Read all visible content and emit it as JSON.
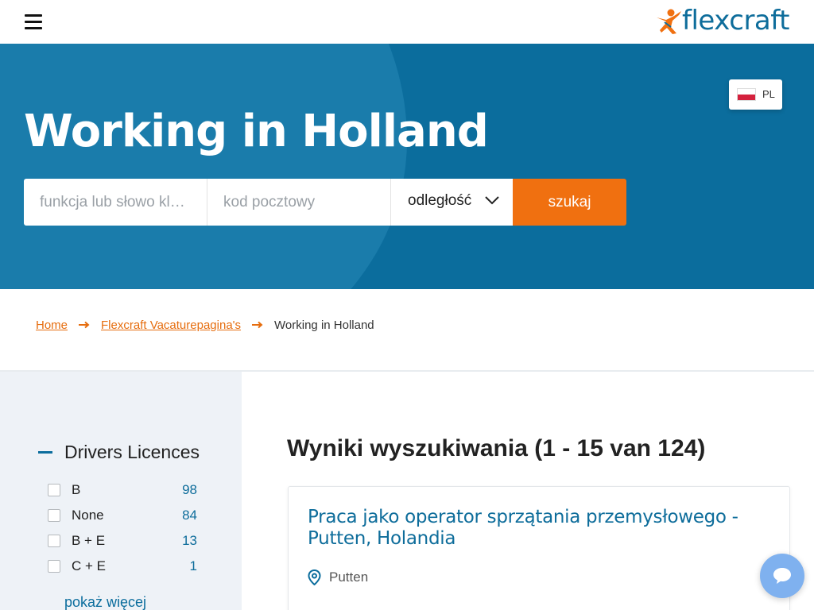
{
  "header": {
    "menu_icon": "hamburger-icon",
    "logo_text": "flexcraft"
  },
  "hero": {
    "title": "Working in Holland",
    "language": {
      "code": "PL",
      "flag": "poland-flag-icon"
    },
    "search": {
      "keyword_placeholder": "funkcja lub słowo kl…",
      "postal_placeholder": "kod pocztowy",
      "distance_value": "odległość",
      "submit_label": "szukaj"
    }
  },
  "breadcrumb": {
    "items": [
      "Home",
      "Flexcraft Vacaturepagina's"
    ],
    "current": "Working in Holland"
  },
  "filters": {
    "title": "Drivers Licences",
    "options": [
      {
        "label": "B",
        "count": "98"
      },
      {
        "label": "None",
        "count": "84"
      },
      {
        "label": "B + E",
        "count": "13"
      },
      {
        "label": "C + E",
        "count": "1"
      }
    ],
    "show_more": "pokaż więcej"
  },
  "results": {
    "heading": "Wyniki wyszukiwania (1 - 15 van 124)",
    "jobs": [
      {
        "title": "Praca jako operator sprzątania przemysłowego - Putten, Holandia",
        "location": "Putten"
      }
    ]
  },
  "colors": {
    "brand_blue": "#0b6d9d",
    "accent_orange": "#f07010",
    "sidebar_bg": "#eef2f7"
  }
}
